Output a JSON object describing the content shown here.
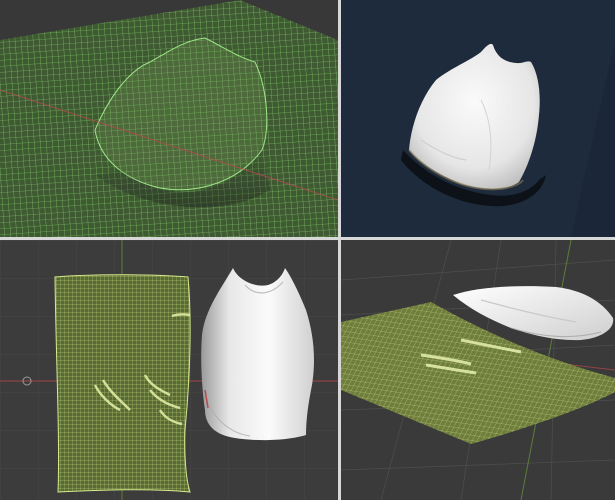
{
  "layout": {
    "type": "2x2-viewport-grid",
    "panel_count": 4
  },
  "viewports": [
    {
      "id": "top-left",
      "content": "draped-mesh-wireframe",
      "shading": "wireframe",
      "mesh_color": "#7fd86a",
      "background": "#3a3a3a"
    },
    {
      "id": "top-right",
      "content": "draped-cloth-solid",
      "shading": "solid",
      "object_color": "#f3f3f3",
      "background": "#1b2738"
    },
    {
      "id": "bottom-left",
      "content": "flat-pattern-and-top-garment",
      "shading": "wireframe+solid",
      "mesh_color": "#c9e07a",
      "object_color": "#f3f3f3",
      "background": "#3c3c3c"
    },
    {
      "id": "bottom-right",
      "content": "flat-pattern-and-folded-cloth",
      "shading": "solid",
      "mesh_color": "#d2e48a",
      "object_color": "#f3f3f3",
      "background": "#3a3a3a"
    }
  ],
  "colors": {
    "axis_x": "#b8484c",
    "axis_y": "#6a9a3a",
    "grid": "#505050",
    "frame": "#d8d8d8"
  }
}
